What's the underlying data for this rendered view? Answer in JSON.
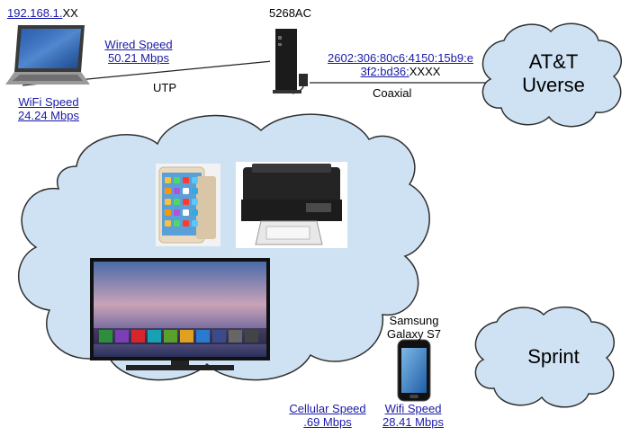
{
  "laptop": {
    "ip_link": "192.168.1.",
    "ip_suffix": "XX",
    "wired_speed_label": "Wired Speed",
    "wired_speed_value": "50.21 Mbps",
    "wifi_speed_label": "WiFi Speed",
    "wifi_speed_value": "24.24 Mbps"
  },
  "cable": {
    "utp": "UTP",
    "coaxial": "Coaxial"
  },
  "gateway": {
    "model": "5268AC",
    "ipv6_line1": "2602:306:80c6:4150:15b9:e",
    "ipv6_line2_link": "3f2:bd36:",
    "ipv6_line2_suffix": "XXXX"
  },
  "clouds": {
    "isp_line1": "AT&T",
    "isp_line2": "Uverse",
    "carrier": "Sprint"
  },
  "phone": {
    "name_line1": "Samsung",
    "name_line2": "Galaxy S7",
    "cellular_speed_label": "Cellular Speed",
    "cellular_speed_value": ".69 Mbps",
    "wifi_speed_label": "Wifi Speed",
    "wifi_speed_value": "28.41 Mbps"
  },
  "colors": {
    "cloud_fill": "#cfe2f3",
    "cloud_stroke": "#2f2f2f",
    "link": "#1a1aa8"
  },
  "icons": [
    "laptop-icon",
    "gateway-icon",
    "tablet-icon",
    "printer-icon",
    "tv-icon",
    "phone-icon"
  ]
}
